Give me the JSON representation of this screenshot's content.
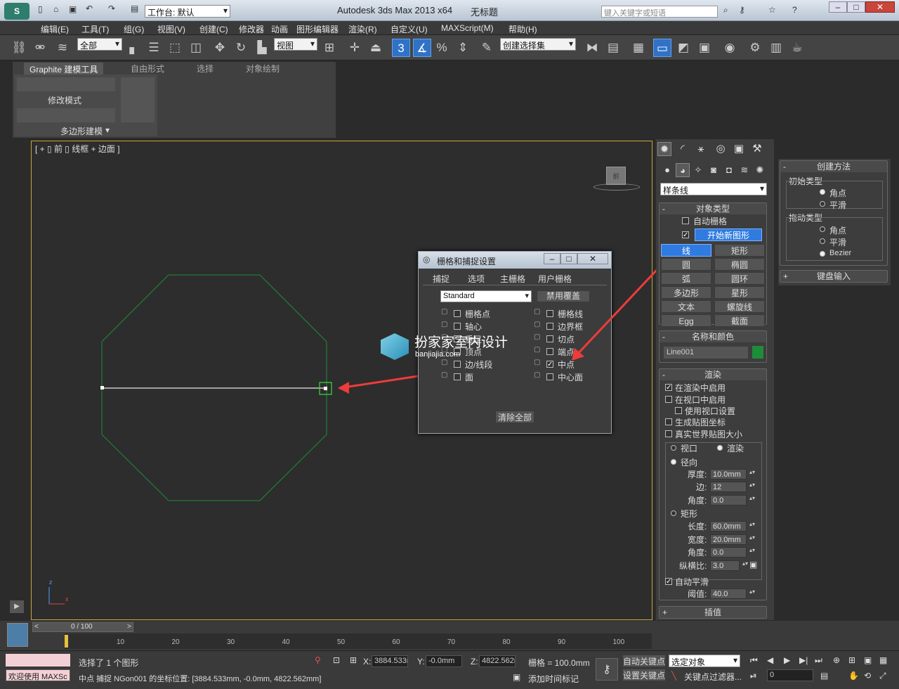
{
  "app": {
    "title": "Autodesk 3ds Max  2013 x64",
    "doc": "无标题",
    "workspace": "工作台: 默认",
    "search_placeholder": "键入关键字或短语"
  },
  "menu": [
    "编辑(E)",
    "工具(T)",
    "组(G)",
    "视图(V)",
    "创建(C)",
    "修改器",
    "动画",
    "图形编辑器",
    "渲染(R)",
    "自定义(U)",
    "MAXScript(M)",
    "帮助(H)"
  ],
  "toolbar": {
    "filter": "全部",
    "ref_coord": "视图",
    "snap_num": "3",
    "named_sel": "创建选择集"
  },
  "ribbon": {
    "tabs": [
      "Graphite 建模工具",
      "自由形式",
      "选择",
      "对象绘制"
    ],
    "mode_label": "修改模式",
    "panel_label": "多边形建模"
  },
  "viewport": {
    "label": "[ + ▯ 前 ▯ 线框 + 边面 ]",
    "viewcube": "前"
  },
  "dialog": {
    "title": "栅格和捕捉设置",
    "tabs": [
      "捕捉",
      "选项",
      "主栅格",
      "用户栅格"
    ],
    "dropdown": "Standard",
    "override_btn": "禁用覆盖",
    "left": [
      {
        "label": "栅格点",
        "checked": false
      },
      {
        "label": "轴心",
        "checked": false
      },
      {
        "label": "垂足",
        "checked": false
      },
      {
        "label": "顶点",
        "checked": false
      },
      {
        "label": "边/线段",
        "checked": false
      },
      {
        "label": "面",
        "checked": false
      }
    ],
    "right": [
      {
        "label": "栅格线",
        "checked": false
      },
      {
        "label": "边界框",
        "checked": false
      },
      {
        "label": "切点",
        "checked": false
      },
      {
        "label": "端点",
        "checked": false
      },
      {
        "label": "中点",
        "checked": true
      },
      {
        "label": "中心面",
        "checked": false
      }
    ],
    "clear_btn": "清除全部"
  },
  "watermark": {
    "title": "扮家家室内设计",
    "url": "banjiajia.com"
  },
  "cmd": {
    "dropdown": "样条线",
    "object_type": {
      "title": "对象类型",
      "autogrid": "自动栅格",
      "start_new": "开始新图形",
      "buttons": [
        "线",
        "矩形",
        "圆",
        "椭圆",
        "弧",
        "圆环",
        "多边形",
        "星形",
        "文本",
        "螺旋线",
        "Egg",
        "截面"
      ]
    },
    "name_color": {
      "title": "名称和颜色",
      "name": "Line001",
      "color": "#1e8c3a"
    },
    "render": {
      "title": "渲染",
      "render_enable": "在渲染中启用",
      "viewport_enable": "在视口中启用",
      "use_vp": "使用视口设置",
      "gen_map": "生成贴图坐标",
      "real_world": "真实世界贴图大小",
      "viewport": "视口",
      "rendering": "渲染",
      "radial": "径向",
      "thickness_l": "厚度:",
      "thickness": "10.0mm",
      "sides_l": "边:",
      "sides": "12",
      "angle_l": "角度:",
      "angle": "0.0",
      "rect": "矩形",
      "length_l": "长度:",
      "length": "60.0mm",
      "width_l": "宽度:",
      "width": "20.0mm",
      "angle2_l": "角度:",
      "angle2": "0.0",
      "aspect_l": "纵横比:",
      "aspect": "3.0",
      "autosmooth": "自动平滑",
      "threshold_l": "阈值:",
      "threshold": "40.0"
    },
    "interp": "插值"
  },
  "creation": {
    "title": "创建方法",
    "initial": "初始类型",
    "corner": "角点",
    "smooth": "平滑",
    "drag": "拖动类型",
    "corner2": "角点",
    "smooth2": "平滑",
    "bezier": "Bezier",
    "keyboard": "键盘输入"
  },
  "timeline": {
    "counter": "0 / 100",
    "ticks": [
      "10",
      "20",
      "30",
      "40",
      "50",
      "60",
      "70",
      "80",
      "90",
      "100"
    ]
  },
  "status": {
    "welcome": "欢迎使用 MAXSc",
    "selected": "选择了 1 个图形",
    "snap_msg": "中点 捕捉 NGon001 的坐标位置: [3884.533mm, -0.0mm, 4822.562mm]",
    "x": "3884.533m",
    "y": "-0.0mm",
    "z": "4822.562m",
    "grid": "栅格 = 100.0mm",
    "autokey": "自动关键点",
    "setkey": "设置关键点",
    "sel_obj": "选定对象",
    "key_filter": "关键点过滤器...",
    "add_time_tag": "添加时间标记",
    "frame": "0"
  }
}
